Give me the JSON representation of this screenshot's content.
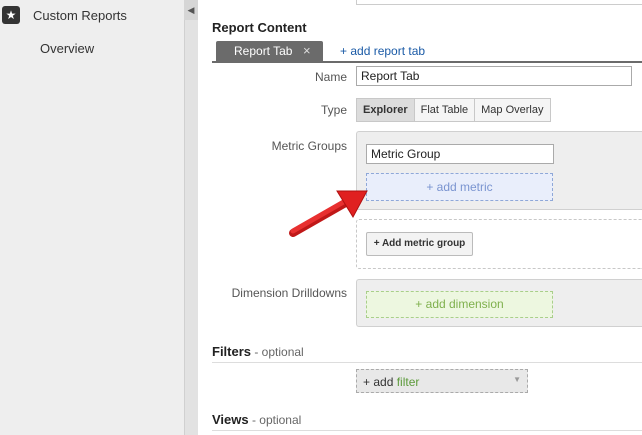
{
  "sidebar": {
    "reports_label": "Custom Reports",
    "overview_label": "Overview"
  },
  "collapse_glyph": "◀",
  "report_content": {
    "title": "Report Content",
    "active_tab": "Report Tab",
    "tab_close": "×",
    "add_tab": "+ add report tab"
  },
  "fields": {
    "name_label": "Name",
    "name_value": "Report Tab",
    "type_label": "Type",
    "type_options": [
      "Explorer",
      "Flat Table",
      "Map Overlay"
    ],
    "type_selected": "Explorer",
    "metric_groups_label": "Metric Groups",
    "metric_group_value": "Metric Group",
    "add_metric": "+ add metric",
    "add_metric_group": "+ Add metric group",
    "dimension_label": "Dimension Drilldowns",
    "add_dimension": "+ add dimension"
  },
  "filters": {
    "title": "Filters",
    "optional": " - optional",
    "add_prefix": "+ add",
    "add_word": "filter",
    "caret": "▼"
  },
  "views": {
    "title": "Views",
    "optional": " - optional"
  },
  "colors": {
    "accent_link": "#1a5aa6",
    "add_metric_blue": "#7a94d0",
    "add_dimension_green": "#7fb04d",
    "annotation_arrow": "#e02020"
  },
  "icons": {
    "reports": "star-icon",
    "collapse": "chevron-left-icon",
    "annotation": "red-arrow-icon"
  }
}
